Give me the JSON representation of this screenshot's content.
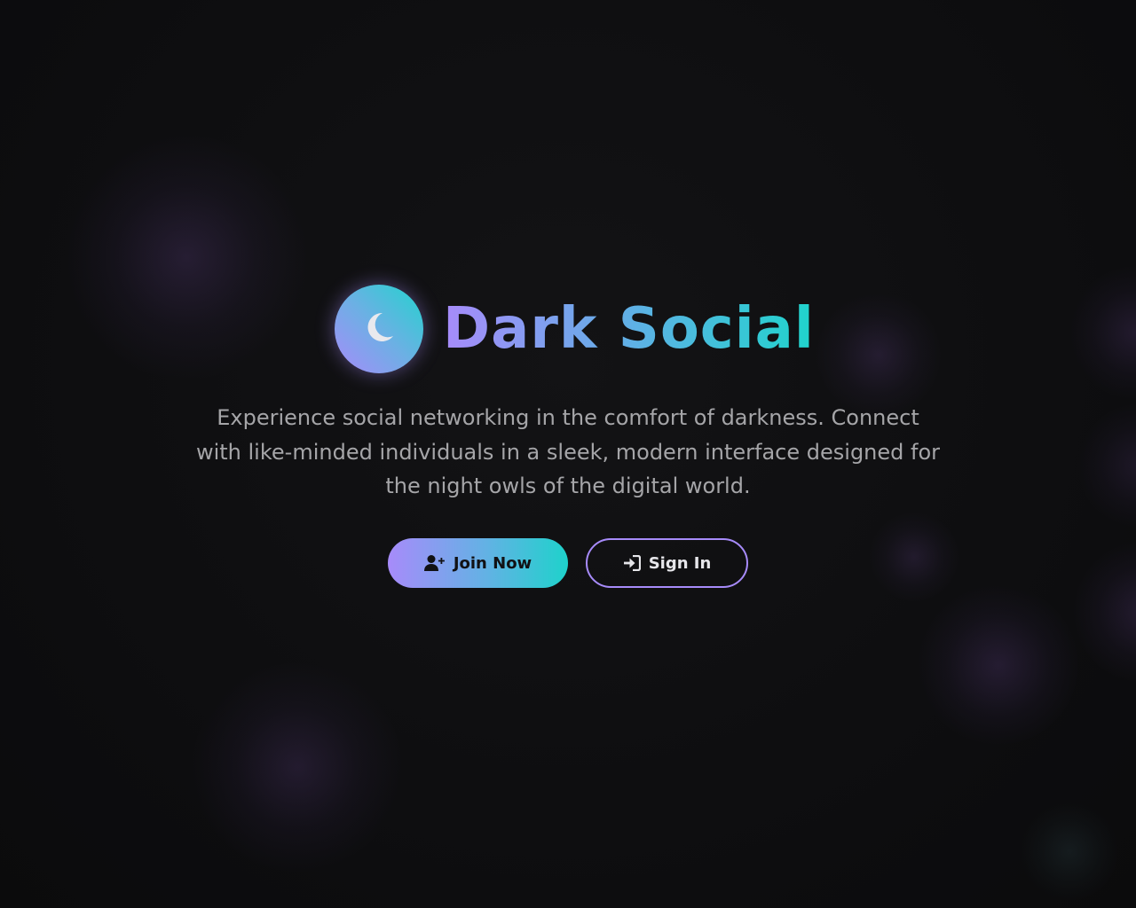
{
  "brand": {
    "title": "Dark Social",
    "logo_icon": "moon-icon"
  },
  "hero": {
    "tagline": "Experience social networking in the comfort of darkness. Connect with like-minded individuals in a sleek, modern interface designed for the night owls of the digital world."
  },
  "actions": {
    "join_label": "Join Now",
    "join_icon": "user-plus-icon",
    "signin_label": "Sign In",
    "signin_icon": "sign-in-icon"
  },
  "colors": {
    "background": "#0e0e10",
    "accent_purple": "#a78bfa",
    "accent_teal": "#1ed2cb",
    "text_muted": "#a5a5a8"
  }
}
